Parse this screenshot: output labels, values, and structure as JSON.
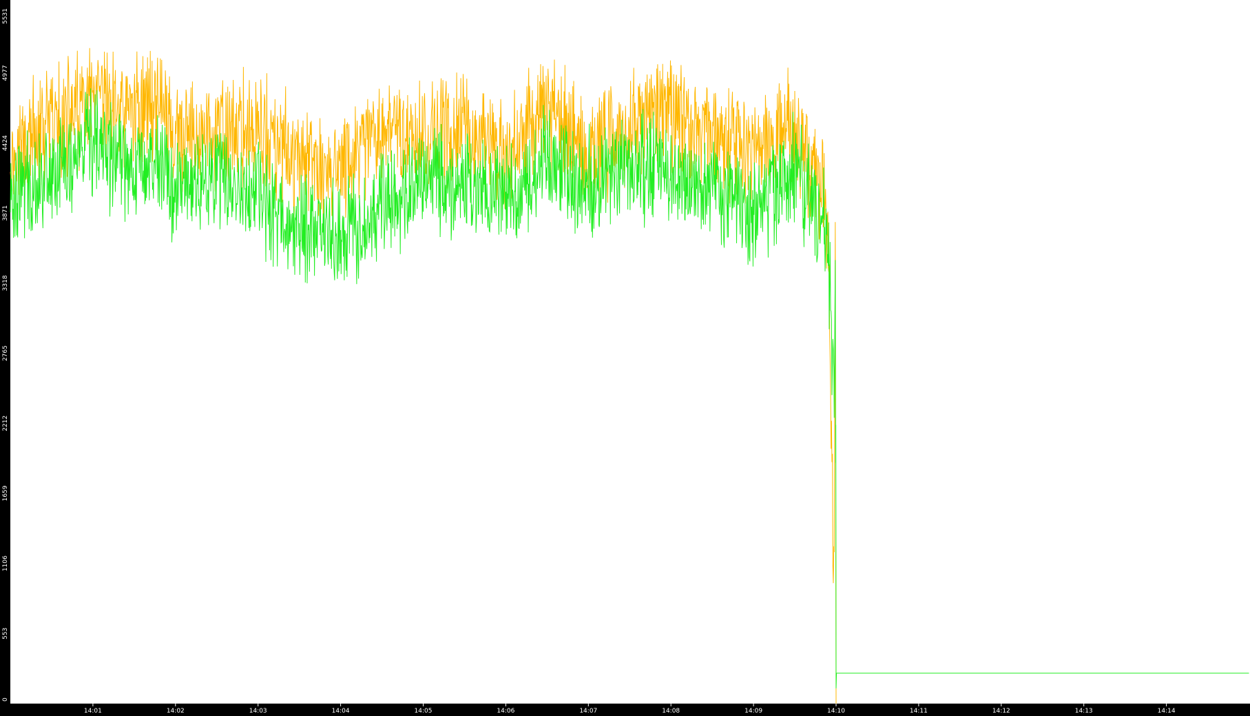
{
  "chart_data": {
    "type": "line",
    "title": "",
    "xlabel": "",
    "ylabel": "",
    "ylim": [
      0,
      5531
    ],
    "y_ticks": [
      "0",
      "553",
      "1106",
      "1659",
      "2212",
      "2765",
      "3318",
      "3871",
      "4424",
      "4977",
      "5531"
    ],
    "x_ticks": [
      "14:01",
      "14:02",
      "14:03",
      "14:04",
      "14:05",
      "14:06",
      "14:07",
      "14:08",
      "14:09",
      "14:10",
      "14:11",
      "14:12",
      "14:13",
      "14:14"
    ],
    "x_range_minutes": [
      0,
      15
    ],
    "grid": false,
    "legend": "none",
    "background_color": "#ffffff",
    "axis_color": "#000000",
    "series": [
      {
        "color": "#ffb700",
        "note_pattern": "noisy",
        "mean": 4480,
        "amplitude": 380,
        "active_until_minute": 10.0,
        "tail_value": 0,
        "points": [
          [
            0.0,
            4310
          ],
          [
            0.5,
            4560
          ],
          [
            1.0,
            4720
          ],
          [
            1.5,
            4680
          ],
          [
            1.8,
            4800
          ],
          [
            2.0,
            4420
          ],
          [
            2.5,
            4490
          ],
          [
            3.0,
            4520
          ],
          [
            3.5,
            4260
          ],
          [
            4.0,
            4200
          ],
          [
            4.5,
            4500
          ],
          [
            5.0,
            4480
          ],
          [
            5.5,
            4540
          ],
          [
            6.0,
            4290
          ],
          [
            6.5,
            4720
          ],
          [
            7.0,
            4330
          ],
          [
            7.5,
            4580
          ],
          [
            8.0,
            4650
          ],
          [
            8.5,
            4500
          ],
          [
            9.0,
            4400
          ],
          [
            9.5,
            4560
          ],
          [
            9.9,
            3900
          ],
          [
            10.0,
            0
          ],
          [
            15.0,
            0
          ]
        ]
      },
      {
        "color": "#22ee22",
        "note_pattern": "noisy",
        "mean": 4150,
        "amplitude": 360,
        "active_until_minute": 10.0,
        "tail_value": 240,
        "points": [
          [
            0.0,
            4050
          ],
          [
            0.5,
            4180
          ],
          [
            1.0,
            4400
          ],
          [
            1.5,
            4250
          ],
          [
            1.8,
            4300
          ],
          [
            2.0,
            4050
          ],
          [
            2.5,
            4150
          ],
          [
            3.0,
            4000
          ],
          [
            3.5,
            3750
          ],
          [
            4.0,
            3700
          ],
          [
            4.5,
            3900
          ],
          [
            5.0,
            4150
          ],
          [
            5.5,
            4100
          ],
          [
            6.0,
            3950
          ],
          [
            6.5,
            4300
          ],
          [
            7.0,
            4100
          ],
          [
            7.5,
            4250
          ],
          [
            8.0,
            4180
          ],
          [
            8.5,
            4050
          ],
          [
            9.0,
            3850
          ],
          [
            9.5,
            4200
          ],
          [
            9.9,
            3700
          ],
          [
            10.0,
            1900
          ],
          [
            10.0,
            240
          ],
          [
            15.0,
            240
          ]
        ]
      }
    ]
  }
}
